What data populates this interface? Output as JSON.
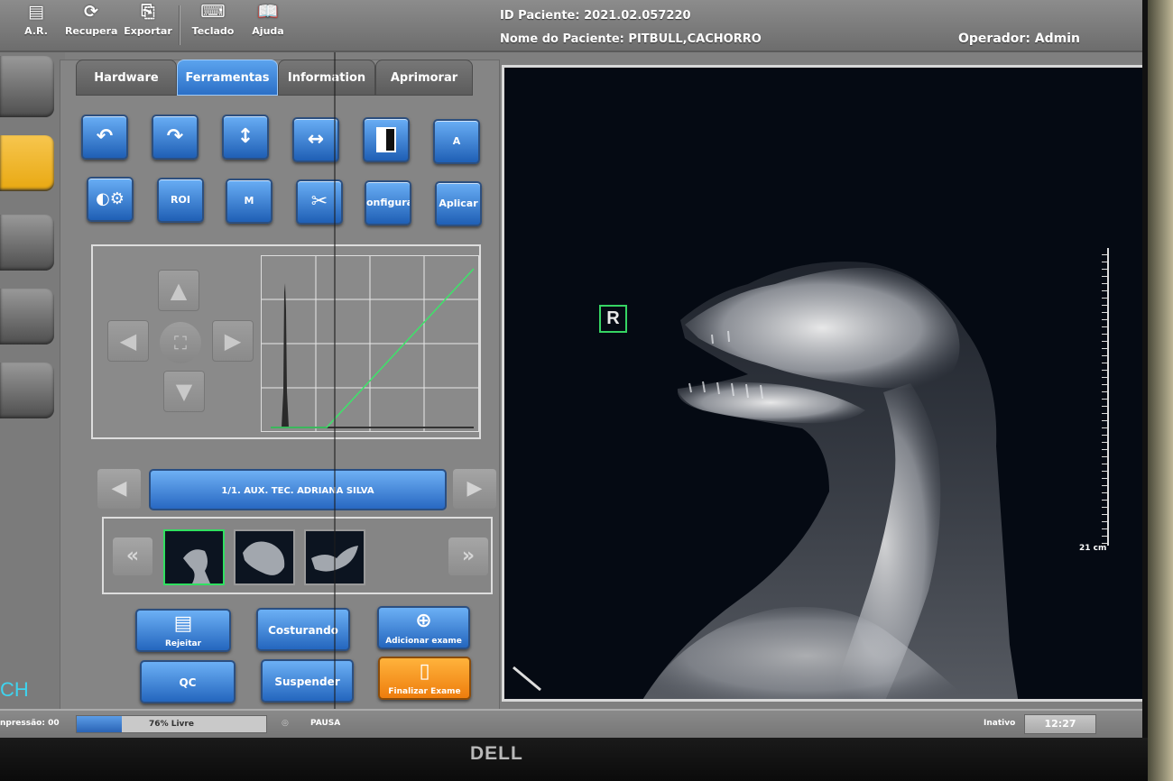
{
  "toolbar": {
    "items": [
      {
        "label": "A.R.",
        "icon": "document-icon"
      },
      {
        "label": "Recuperar",
        "icon": "refresh-icon"
      },
      {
        "label": "Exportar",
        "icon": "export-icon"
      },
      {
        "label": "Teclado",
        "icon": "keyboard-icon"
      },
      {
        "label": "Ajuda",
        "icon": "book-icon"
      }
    ]
  },
  "patient": {
    "id_label": "ID Paciente:",
    "id_value": "2021.02.057220",
    "name_label": "Nome do Paciente:",
    "name_value": "PITBULL,CACHORRO",
    "operator_label": "Operador:",
    "operator_value": "Admin"
  },
  "left_side": {
    "partial_text": "CH"
  },
  "tabs": [
    {
      "label": "Hardware",
      "active": false
    },
    {
      "label": "Ferramentas",
      "active": true
    },
    {
      "label": "Information",
      "active": false
    },
    {
      "label": "Aprimorar",
      "active": false
    }
  ],
  "tools_row1": [
    {
      "icon": "rotate-left-icon",
      "text": ""
    },
    {
      "icon": "rotate-right-icon",
      "text": ""
    },
    {
      "icon": "flip-vertical-icon",
      "text": ""
    },
    {
      "icon": "flip-horizontal-icon",
      "text": ""
    },
    {
      "icon": "invert-icon",
      "text": ""
    },
    {
      "icon": "annotation-icon",
      "text": "A"
    }
  ],
  "tools_row2": [
    {
      "icon": "contrast-settings-icon",
      "text": ""
    },
    {
      "icon": "",
      "text": "ROI"
    },
    {
      "icon": "",
      "text": "M"
    },
    {
      "icon": "scissors-icon",
      "text": ""
    },
    {
      "icon": "",
      "text": "onfigura"
    },
    {
      "icon": "",
      "text": "Aplicar"
    }
  ],
  "navigator": {
    "up": "▲",
    "down": "▼",
    "left": "◀",
    "right": "▶",
    "center_icon": "fit-icon"
  },
  "series": {
    "label": "1/1. AUX. TEC. ADRIANA SILVA",
    "prev": "◀",
    "next": "▶"
  },
  "thumbnails": {
    "prev": "«",
    "next": "»",
    "count": 3,
    "selected": 0
  },
  "actions": {
    "reject": "Rejeitar",
    "stitch": "Costurando",
    "add_exam": "Adicionar exame",
    "qc": "QC",
    "suspend": "Suspender",
    "finish": "Finalizar Exame"
  },
  "viewer": {
    "orientation_marker": "R",
    "scale_label": "21 cm"
  },
  "status": {
    "left_text": "npressão: 00",
    "storage_text": "76% Livre",
    "storage_used_fraction": 0.24,
    "pause": "PAUSA",
    "state": "Inativo",
    "time": "12:27"
  },
  "monitor": {
    "brand": "DELL"
  },
  "colors": {
    "accent_blue": "#2b6fc6",
    "selected_green": "#30e060",
    "orange": "#ee7d0d",
    "marker_green": "#36d563"
  }
}
